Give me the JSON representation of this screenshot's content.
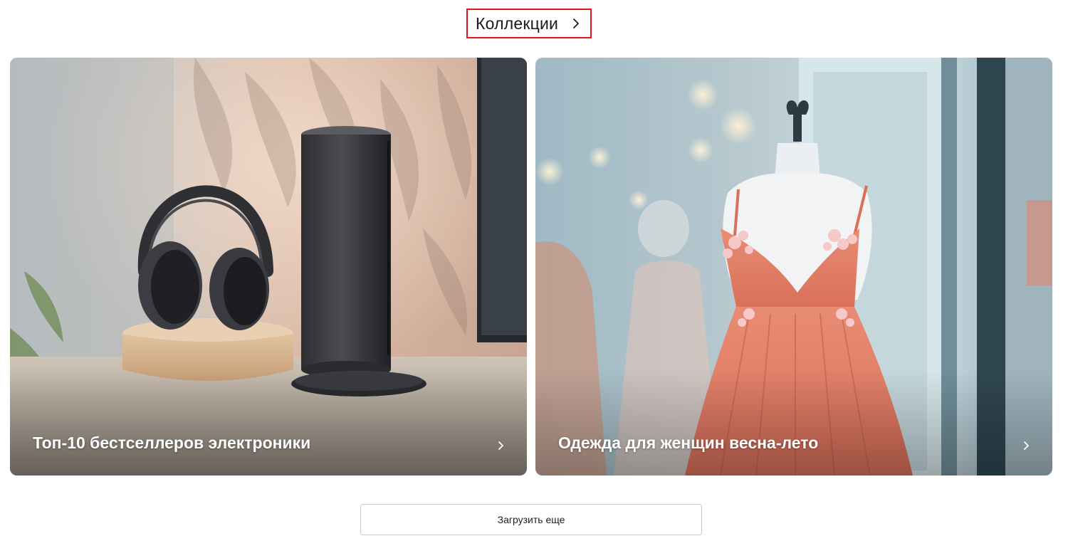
{
  "collections_header": {
    "title": "Коллекции",
    "icon": "chevron-right-icon"
  },
  "cards": [
    {
      "title": "Топ-10 бестселлеров электроники",
      "image": "headphones-and-speaker-photo",
      "icon": "chevron-right-icon"
    },
    {
      "title": "Одежда для женщин весна-лето",
      "image": "dress-on-mannequin-photo",
      "icon": "chevron-right-icon"
    }
  ],
  "load_more": {
    "label": "Загрузить еще"
  },
  "colors": {
    "highlight_border": "#e0141e",
    "text": "#1a1a1a",
    "button_border": "#c9c9c9"
  }
}
